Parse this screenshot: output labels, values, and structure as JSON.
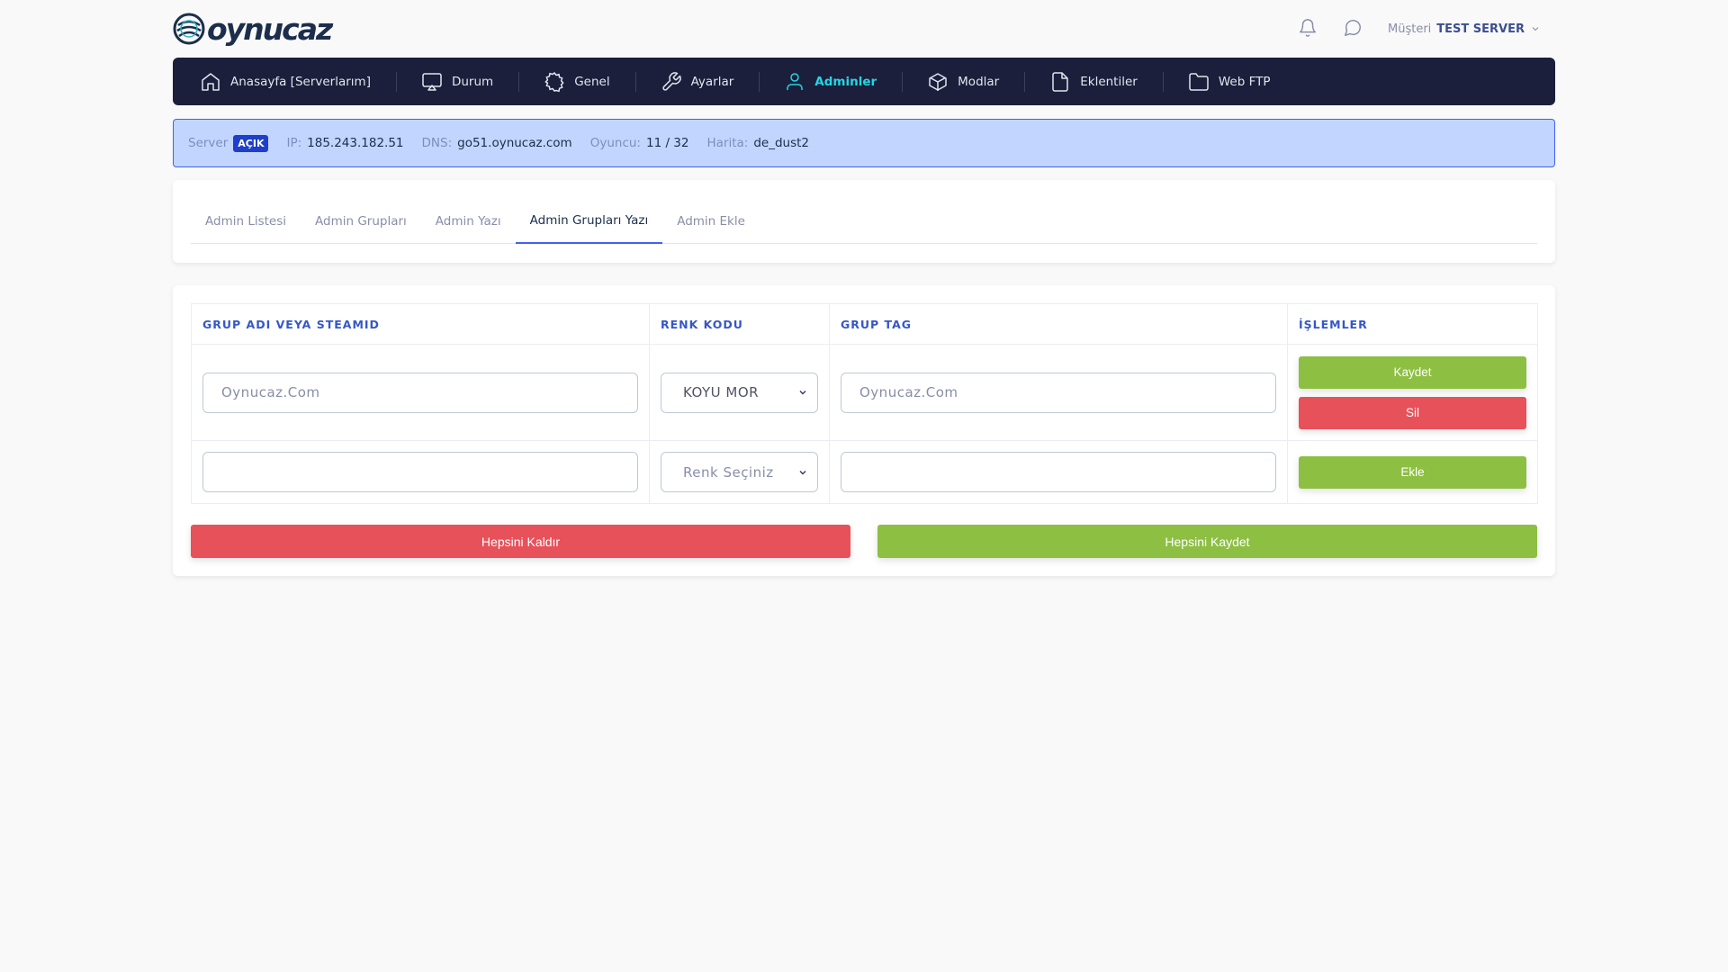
{
  "brand": {
    "logo_text": "oynucaz"
  },
  "header": {
    "icons": [
      "bell-icon",
      "chat-icon"
    ],
    "user_label": "Müşteri",
    "user_name": "TEST SERVER"
  },
  "nav": {
    "items": [
      {
        "label": "Anasayfa [Serverlarım]",
        "icon": "home-icon"
      },
      {
        "label": "Durum",
        "icon": "monitor-icon"
      },
      {
        "label": "Genel",
        "icon": "gear-icon"
      },
      {
        "label": "Ayarlar",
        "icon": "wrench-icon"
      },
      {
        "label": "Adminler",
        "icon": "user-icon",
        "active": true
      },
      {
        "label": "Modlar",
        "icon": "box-icon"
      },
      {
        "label": "Eklentiler",
        "icon": "file-icon"
      },
      {
        "label": "Web FTP",
        "icon": "folder-icon"
      }
    ]
  },
  "server_info": {
    "server_label": "Server",
    "status": "AÇIK",
    "ip_label": "IP:",
    "ip": "185.243.182.51",
    "dns_label": "DNS:",
    "dns": "go51.oynucaz.com",
    "players_label": "Oyuncu:",
    "players": "11 / 32",
    "map_label": "Harita:",
    "map": "de_dust2"
  },
  "tabs": [
    {
      "label": "Admin Listesi"
    },
    {
      "label": "Admin Grupları"
    },
    {
      "label": "Admin Yazı"
    },
    {
      "label": "Admin Grupları Yazı",
      "active": true
    },
    {
      "label": "Admin Ekle"
    }
  ],
  "table": {
    "headers": [
      "GRUP ADI VEYA STEAMID",
      "RENK KODU",
      "GRUP TAG",
      "İŞLEMLER"
    ],
    "row1": {
      "group_name_placeholder": "Oynucaz.Com",
      "color": "KOYU MOR",
      "tag_placeholder": "Oynucaz.Com",
      "save_label": "Kaydet",
      "delete_label": "Sil"
    },
    "row2": {
      "group_name_placeholder": "",
      "color": "Renk Seçiniz",
      "tag_placeholder": "",
      "add_label": "Ekle"
    }
  },
  "actions": {
    "remove_all_label": "Hepsini Kaldır",
    "save_all_label": "Hepsini Kaydet"
  },
  "colors": {
    "nav_bg": "#1b1f3b",
    "accent": "#4361ee",
    "active_nav": "#25d5e4",
    "green": "#8dbf42",
    "red": "#e7515a",
    "info_bg": "#c2d5ff"
  }
}
